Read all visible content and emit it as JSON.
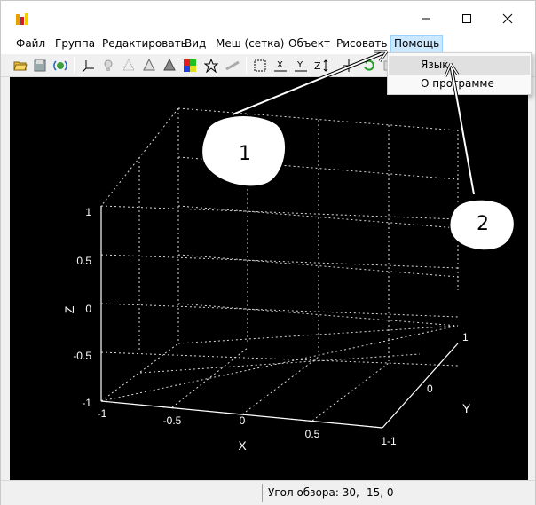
{
  "menu": {
    "items": [
      "Файл",
      "Группа",
      "Редактировать",
      "Вид",
      "Меш (сетка)",
      "Объект",
      "Рисовать",
      "Помощь"
    ],
    "open_item": "Помощь"
  },
  "help_menu": {
    "items": [
      "Язык",
      "О программе"
    ],
    "highlighted": "Язык"
  },
  "toolbar": {
    "icons": [
      "open-folder-icon",
      "save-icon",
      "satellite-icon",
      "axes-icon",
      "light-icon",
      "cone-wire-icon",
      "cone-icon",
      "cone-solid-icon",
      "colormap-icon",
      "star-icon",
      "ruler-icon",
      "box-view-icon",
      "x-axis-view-icon",
      "y-axis-view-icon",
      "z-axis-view-icon",
      "pan-icon",
      "rotate-icon",
      "extra-icon"
    ]
  },
  "plot": {
    "xlabel": "X",
    "ylabel": "Y",
    "zlabel": "Z",
    "x_ticks": [
      "-1",
      "-0.5",
      "0",
      "0.5",
      "1-1"
    ],
    "y_ticks": [
      "0",
      "1"
    ],
    "z_ticks": [
      "1",
      "0.5",
      "0",
      "-0.5",
      "-1"
    ],
    "view_angles": [
      30,
      -15,
      0
    ],
    "grid": true
  },
  "annotations": {
    "callout_1": "1",
    "callout_2": "2"
  },
  "status": {
    "view_angle": "Угол обзора: 30, -15, 0"
  }
}
